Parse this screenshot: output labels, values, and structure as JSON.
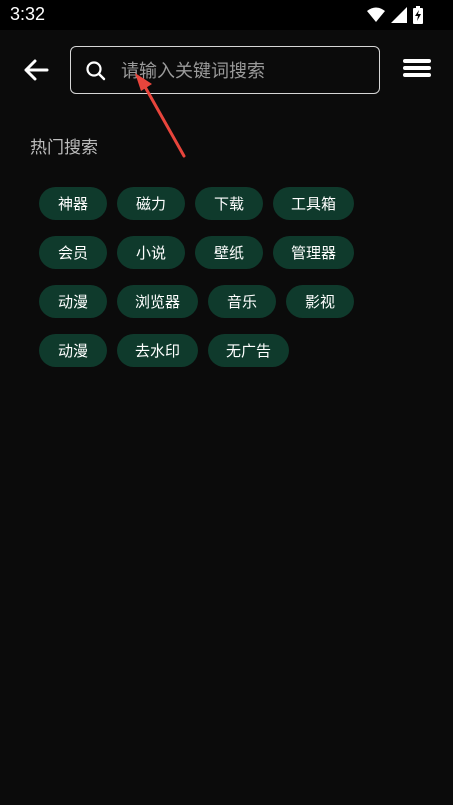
{
  "status_bar": {
    "time": "3:32"
  },
  "search": {
    "placeholder": "请输入关键词搜索",
    "value": ""
  },
  "hot_search": {
    "title": "热门搜索",
    "rows": [
      [
        "神器",
        "磁力",
        "下载",
        "工具箱"
      ],
      [
        "会员",
        "小说",
        "壁纸",
        "管理器"
      ],
      [
        "动漫",
        "浏览器",
        "音乐",
        "影视"
      ],
      [
        "动漫",
        "去水印",
        "无广告"
      ]
    ]
  },
  "colors": {
    "background": "#0b0b0b",
    "tag_background": "#0f3a2c",
    "annotation_arrow": "#e8453c"
  },
  "icons": [
    "back-arrow-icon",
    "search-icon",
    "menu-icon",
    "wifi-icon",
    "signal-icon",
    "battery-icon"
  ]
}
